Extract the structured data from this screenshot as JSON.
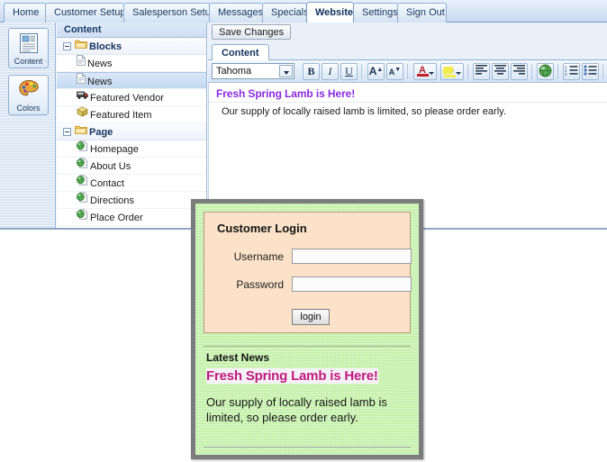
{
  "nav": {
    "tabs": [
      {
        "label": "Home",
        "active": false
      },
      {
        "label": "Customer Setup",
        "active": false
      },
      {
        "label": "Salesperson Setup",
        "active": false
      },
      {
        "label": "Messages",
        "active": false
      },
      {
        "label": "Specials",
        "active": false
      },
      {
        "label": "Website",
        "active": true
      },
      {
        "label": "Settings",
        "active": false
      },
      {
        "label": "Sign Out",
        "active": false
      }
    ]
  },
  "rail": {
    "buttons": [
      {
        "label": "Content",
        "icon": "document-page-icon"
      },
      {
        "label": "Colors",
        "icon": "palette-icon"
      }
    ]
  },
  "tree": {
    "header": "Content",
    "nodes": [
      {
        "label": "Blocks",
        "type": "group",
        "icon": "folder-icon",
        "expanded": true,
        "selected": false
      },
      {
        "label": "News",
        "type": "child",
        "icon": "document-icon",
        "selected": false
      },
      {
        "label": "News",
        "type": "child",
        "icon": "document-icon",
        "selected": true
      },
      {
        "label": "Featured Vendor",
        "type": "child",
        "icon": "truck-icon",
        "selected": false
      },
      {
        "label": "Featured Item",
        "type": "child",
        "icon": "package-icon",
        "selected": false
      },
      {
        "label": "Page",
        "type": "group",
        "icon": "folder-icon",
        "expanded": true,
        "selected": false
      },
      {
        "label": "Homepage",
        "type": "child",
        "icon": "globe-page-icon",
        "selected": false
      },
      {
        "label": "About Us",
        "type": "child",
        "icon": "globe-page-icon",
        "selected": false
      },
      {
        "label": "Contact",
        "type": "child",
        "icon": "globe-page-icon",
        "selected": false
      },
      {
        "label": "Directions",
        "type": "child",
        "icon": "globe-page-icon",
        "selected": false
      },
      {
        "label": "Place Order",
        "type": "child",
        "icon": "globe-page-icon",
        "selected": false
      }
    ]
  },
  "editor": {
    "save_label": "Save Changes",
    "tab_label": "Content",
    "font_value": "Tahoma",
    "toolbar": [
      {
        "name": "bold",
        "glyph": "B",
        "style": "bold"
      },
      {
        "name": "italic",
        "glyph": "I",
        "style": "italic"
      },
      {
        "name": "underline",
        "glyph": "U",
        "style": "underline"
      },
      {
        "name": "grow-font",
        "glyph": "A",
        "style": "plain"
      },
      {
        "name": "shrink-font",
        "glyph": "A",
        "style": "plain"
      },
      {
        "name": "font-color",
        "glyph": "A",
        "style": "colorbar"
      },
      {
        "name": "highlight-color",
        "glyph": "ab",
        "style": "colorbar"
      },
      {
        "name": "align-left",
        "glyph": "",
        "style": "lines"
      },
      {
        "name": "align-center",
        "glyph": "",
        "style": "lines"
      },
      {
        "name": "align-right",
        "glyph": "",
        "style": "lines"
      },
      {
        "name": "insert-link",
        "glyph": "",
        "style": "globe"
      },
      {
        "name": "ordered-list",
        "glyph": "",
        "style": "list"
      },
      {
        "name": "unordered-list",
        "glyph": "",
        "style": "list"
      },
      {
        "name": "edit-source",
        "glyph": "",
        "style": "pencil"
      }
    ],
    "heading": "Fresh Spring Lamb is Here!",
    "body": "Our supply of locally raised lamb is limited, so please order early.",
    "heading_color": "#8a2be2"
  },
  "preview": {
    "login": {
      "title": "Customer Login",
      "username_label": "Username",
      "username_value": "",
      "password_label": "Password",
      "password_value": "",
      "button_label": "login"
    },
    "news": {
      "section_title": "Latest News",
      "headline": "Fresh Spring Lamb is Here!",
      "body": "Our supply of locally raised lamb is limited, so please order early.",
      "headline_color": "#c2187f"
    },
    "background_color": "#c3f0a8",
    "login_background_color": "#fbe2c8",
    "frame_color": "#7c7c7c"
  }
}
